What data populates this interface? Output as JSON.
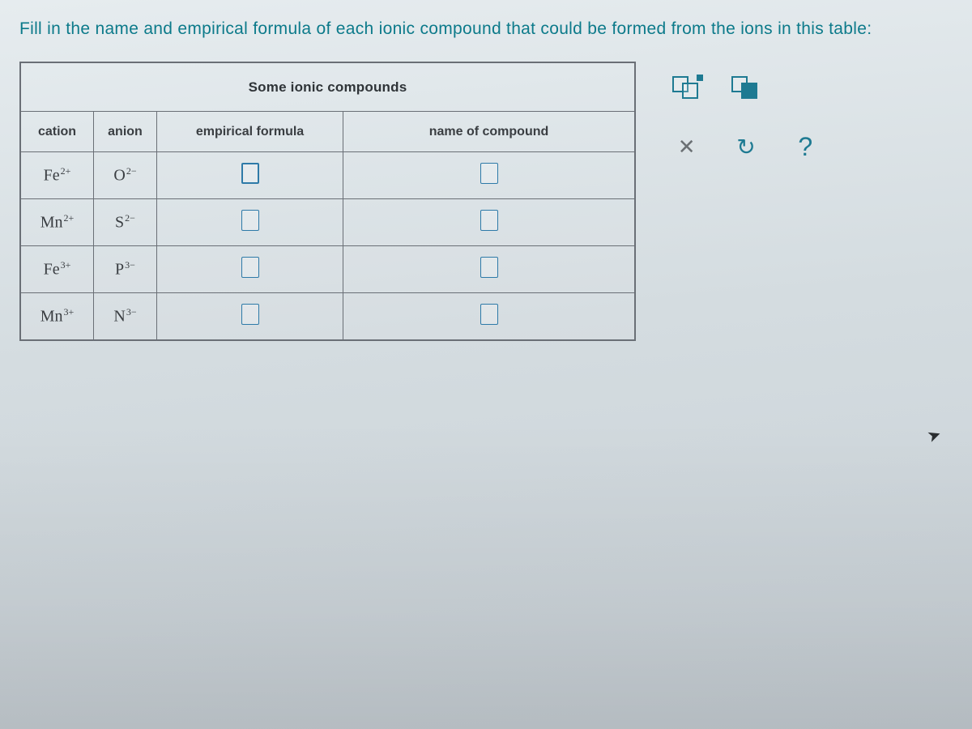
{
  "instruction": "Fill in the name and empirical formula of each ionic compound that could be formed from the ions in this table:",
  "table": {
    "title": "Some ionic compounds",
    "headers": {
      "cation": "cation",
      "anion": "anion",
      "formula": "empirical formula",
      "name": "name of compound"
    },
    "rows": [
      {
        "cation_base": "Fe",
        "cation_charge": "2+",
        "anion_base": "O",
        "anion_charge": "2−"
      },
      {
        "cation_base": "Mn",
        "cation_charge": "2+",
        "anion_base": "S",
        "anion_charge": "2−"
      },
      {
        "cation_base": "Fe",
        "cation_charge": "3+",
        "anion_base": "P",
        "anion_charge": "3−"
      },
      {
        "cation_base": "Mn",
        "cation_charge": "3+",
        "anion_base": "N",
        "anion_charge": "3−"
      }
    ]
  },
  "toolbox": {
    "help_label": "?"
  }
}
